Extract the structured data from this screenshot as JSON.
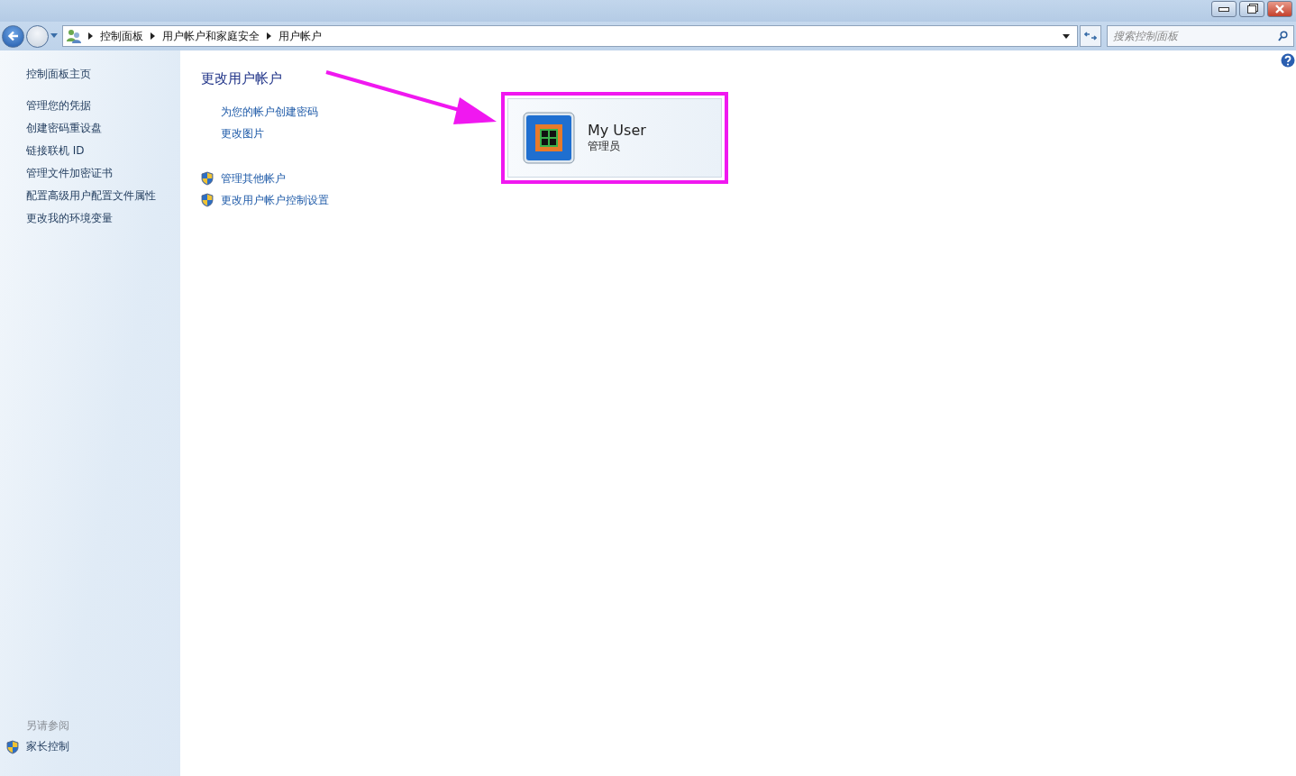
{
  "address_bar": {
    "breadcrumbs": [
      "控制面板",
      "用户帐户和家庭安全",
      "用户帐户"
    ]
  },
  "search": {
    "placeholder": "搜索控制面板"
  },
  "sidebar": {
    "home": "控制面板主页",
    "tasks": [
      "管理您的凭据",
      "创建密码重设盘",
      "链接联机 ID",
      "管理文件加密证书",
      "配置高级用户配置文件属性",
      "更改我的环境变量"
    ],
    "see_also": {
      "heading": "另请参阅",
      "links": [
        {
          "label": "家长控制",
          "shield": true
        }
      ]
    }
  },
  "main": {
    "heading": "更改用户帐户",
    "links": [
      {
        "label": "为您的帐户创建密码",
        "shield": false
      },
      {
        "label": "更改图片",
        "shield": false
      },
      {
        "label": "管理其他帐户",
        "shield": true
      },
      {
        "label": "更改用户帐户控制设置",
        "shield": true
      }
    ],
    "account": {
      "name": "My User",
      "role": "管理员",
      "highlighted": true
    }
  }
}
